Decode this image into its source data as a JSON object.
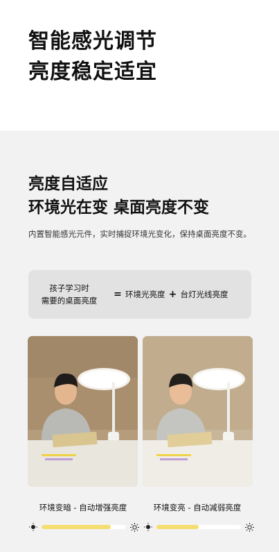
{
  "hero": {
    "title_line1": "智能感光调节",
    "title_line2": "亮度稳定适宜"
  },
  "section": {
    "title_line1": "亮度自适应",
    "title_line2": "环境光在变 桌面亮度不变",
    "description": "内置智能感光元件，实时捕捉环境光变化，保持桌面亮度不变。"
  },
  "formula": {
    "result_line1": "孩子学习时",
    "result_line2": "需要的桌面亮度",
    "equals": "=",
    "term1": "环境光亮度",
    "plus": "+",
    "term2": "台灯光线亮度"
  },
  "panels": [
    {
      "caption": "环境变暗 - 自动增强亮度",
      "lamp_brightness": 0.82,
      "icons": [
        "sun-dim-icon",
        "sun-bright-icon"
      ]
    },
    {
      "caption": "环境变亮 - 自动减弱亮度",
      "lamp_brightness": 0.5,
      "icons": [
        "sun-dim-icon",
        "sun-bright-icon"
      ]
    }
  ],
  "colors": {
    "accent": "#f6dd70",
    "section_bg": "#f2f2f2",
    "formula_bg": "#e2e2e2"
  }
}
